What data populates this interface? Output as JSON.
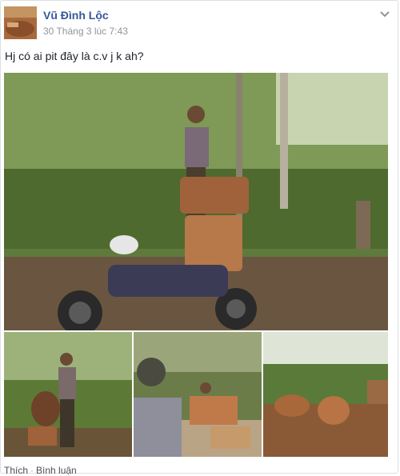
{
  "post": {
    "author": "Vũ Đình Lộc",
    "timestamp": "30 Tháng 3 lúc 7:43",
    "text": "Hj có ai pit đây là c.v j k ah?"
  },
  "icons": {
    "menu": "chevron-down-icon",
    "avatar": "profile-photo"
  },
  "photos": [
    {
      "name": "man-on-motorbike-with-logs"
    },
    {
      "name": "man-carrying-log"
    },
    {
      "name": "men-cutting-wood"
    },
    {
      "name": "felled-logs-in-clearing"
    }
  ],
  "actions": {
    "like": "Thích",
    "separator": "·",
    "comment": "Bình luận"
  },
  "colors": {
    "author": "#365899",
    "meta": "#90949c",
    "text": "#1d2129"
  }
}
